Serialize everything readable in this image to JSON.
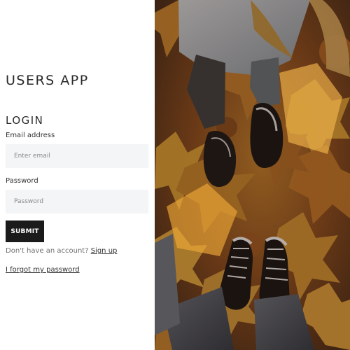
{
  "app": {
    "title": "USERS APP"
  },
  "login": {
    "heading": "LOGIN",
    "email_label": "Email address",
    "email_placeholder": "Enter email",
    "password_label": "Password",
    "password_placeholder": "Password",
    "submit_label": "SUBMIT",
    "signup_prompt": "Don't have an account?",
    "signup_link": "Sign up",
    "forgot_password_link": "I forgot my password"
  },
  "theme": {
    "text": "#2a2a2a",
    "input_background": "#f4f5f7",
    "button_background": "#1b1b1b",
    "button_text": "#ffffff",
    "photo_palette": [
      "#d08b2b",
      "#e7a936",
      "#8b4c1c",
      "#2c1f16"
    ]
  },
  "photo": {
    "subject_icons": [
      "autumn-leaves-photo",
      "sneakers-icon",
      "jeans-icon"
    ]
  }
}
